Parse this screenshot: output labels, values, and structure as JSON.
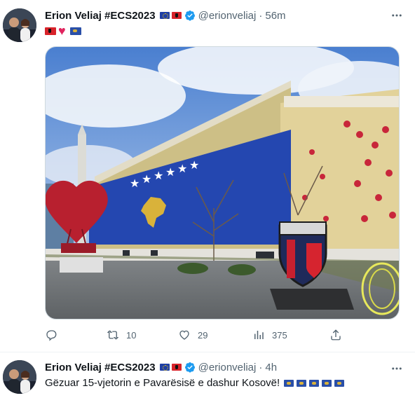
{
  "tweets": [
    {
      "author": "Erion Veliaj #ECS2023",
      "handle": "@erionveliaj",
      "time": "56m",
      "stats": {
        "replies": "",
        "retweets": "10",
        "likes": "29",
        "views": "375"
      }
    },
    {
      "author": "Erion Veliaj #ECS2023",
      "handle": "@erionveliaj",
      "time": "4h",
      "text": "Gëzuar 15-vjetorin e Pavarësisë e dashur Kosovë!"
    }
  ],
  "separator": "·",
  "icons": {
    "verified": "verified-badge-icon",
    "more": "more-options-icon",
    "reply": "reply-icon",
    "retweet": "retweet-icon",
    "like": "heart-outline-icon",
    "views": "analytics-icon",
    "share": "share-icon"
  },
  "colors": {
    "text": "#0f1419",
    "secondary": "#536471",
    "verified": "#1d9bf0",
    "kosovo_blue": "#2a4fa8",
    "kosovo_gold": "#d9b23a",
    "heart_red": "#e0245e"
  }
}
